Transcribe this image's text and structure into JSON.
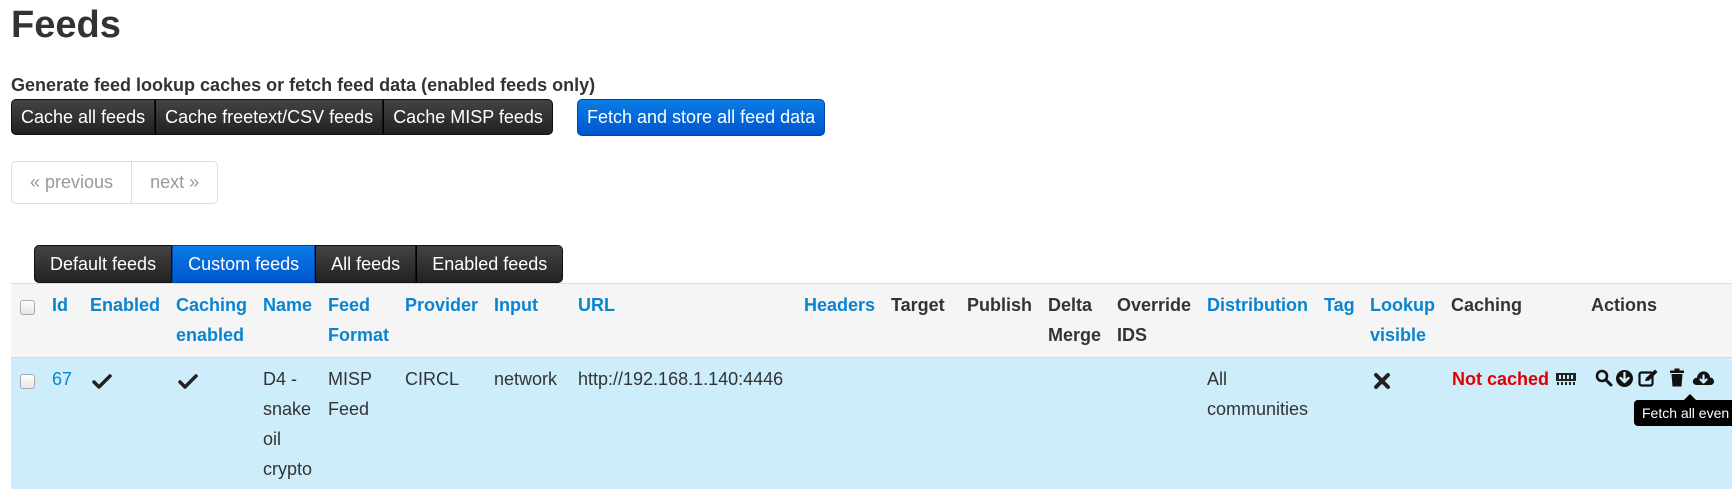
{
  "page_title": "Feeds",
  "subheading": "Generate feed lookup caches or fetch feed data (enabled feeds only)",
  "cache_buttons": [
    "Cache all feeds",
    "Cache freetext/CSV feeds",
    "Cache MISP feeds"
  ],
  "fetch_all_button": "Fetch and store all feed data",
  "pagination": {
    "previous": "« previous",
    "next": "next »"
  },
  "filter_tabs": [
    {
      "label": "Default feeds",
      "active": false
    },
    {
      "label": "Custom feeds",
      "active": true
    },
    {
      "label": "All feeds",
      "active": false
    },
    {
      "label": "Enabled feeds",
      "active": false
    }
  ],
  "table": {
    "headers": {
      "id": "Id",
      "enabled": "Enabled",
      "caching_enabled": [
        "Caching",
        "enabled"
      ],
      "name": "Name",
      "feed_format": [
        "Feed",
        "Format"
      ],
      "provider": "Provider",
      "input": "Input",
      "url": "URL",
      "headers": "Headers",
      "target": "Target",
      "publish": "Publish",
      "delta_merge": [
        "Delta",
        "Merge"
      ],
      "override_ids": [
        "Override",
        "IDS"
      ],
      "distribution": "Distribution",
      "tag": "Tag",
      "lookup_visible": [
        "Lookup",
        "visible"
      ],
      "caching": "Caching",
      "actions": "Actions"
    },
    "rows": [
      {
        "id": "67",
        "name": [
          "D4 -",
          "snake",
          "oil",
          "crypto"
        ],
        "feed_format": [
          "MISP",
          "Feed"
        ],
        "provider": "CIRCL",
        "input": "network",
        "url": "http://192.168.1.140:4446",
        "distribution": [
          "All",
          "communities"
        ],
        "caching": "Not cached"
      }
    ]
  },
  "tooltip": "Fetch all even",
  "colors": {
    "link": "#0a84d0",
    "primary": "#0055cc",
    "row_highlight": "#cdedfb",
    "not_cached": "#e00000"
  },
  "icons": [
    "check-icon",
    "check-icon",
    "cross-icon",
    "memory-icon",
    "search-icon",
    "download-circle-icon",
    "edit-icon",
    "trash-icon",
    "cloud-download-icon"
  ]
}
